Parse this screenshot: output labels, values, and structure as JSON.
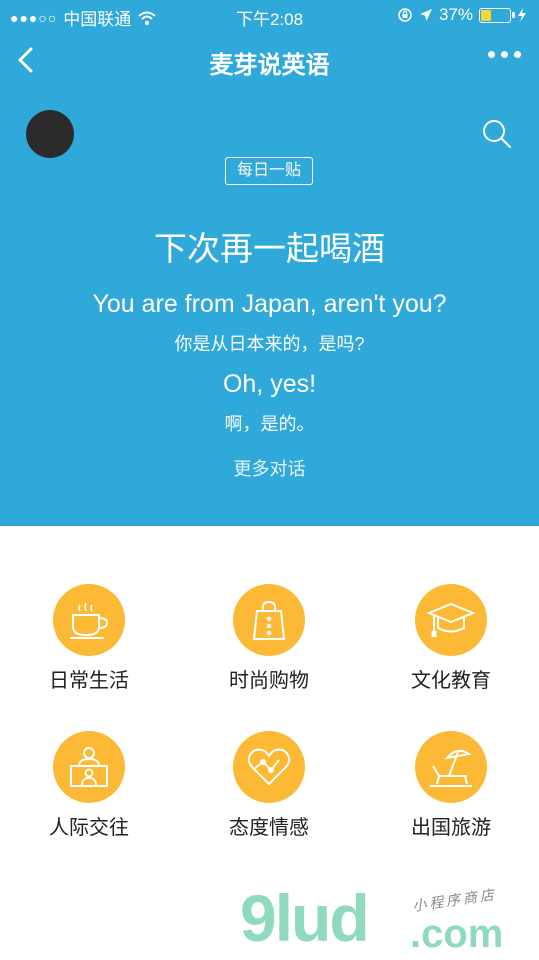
{
  "status_bar": {
    "signal": "●●●○○",
    "carrier": "中国联通",
    "time": "下午2:08",
    "battery": "37%"
  },
  "nav": {
    "title": "麦芽说英语"
  },
  "card": {
    "badge": "每日一贴",
    "title": "下次再一起喝酒",
    "line1_en": "You are from Japan, aren't you?",
    "line1_cn": "你是从日本来的，是吗?",
    "line2_en": "Oh, yes!",
    "line2_cn": "啊，是的。",
    "more_link": "更多对话"
  },
  "categories": [
    {
      "label": "日常生活",
      "icon": "tea-cup-icon"
    },
    {
      "label": "时尚购物",
      "icon": "shopping-bag-icon"
    },
    {
      "label": "文化教育",
      "icon": "graduation-cap-icon"
    },
    {
      "label": "人际交往",
      "icon": "people-icon"
    },
    {
      "label": "态度情感",
      "icon": "heart-icon"
    },
    {
      "label": "出国旅游",
      "icon": "beach-chair-icon"
    }
  ],
  "watermark": {
    "brand": "9lud",
    "domain": ".com",
    "tagline": "小程序商店"
  },
  "colors": {
    "header_bg": "#2fa9d9",
    "category_circle": "#fbb935"
  }
}
